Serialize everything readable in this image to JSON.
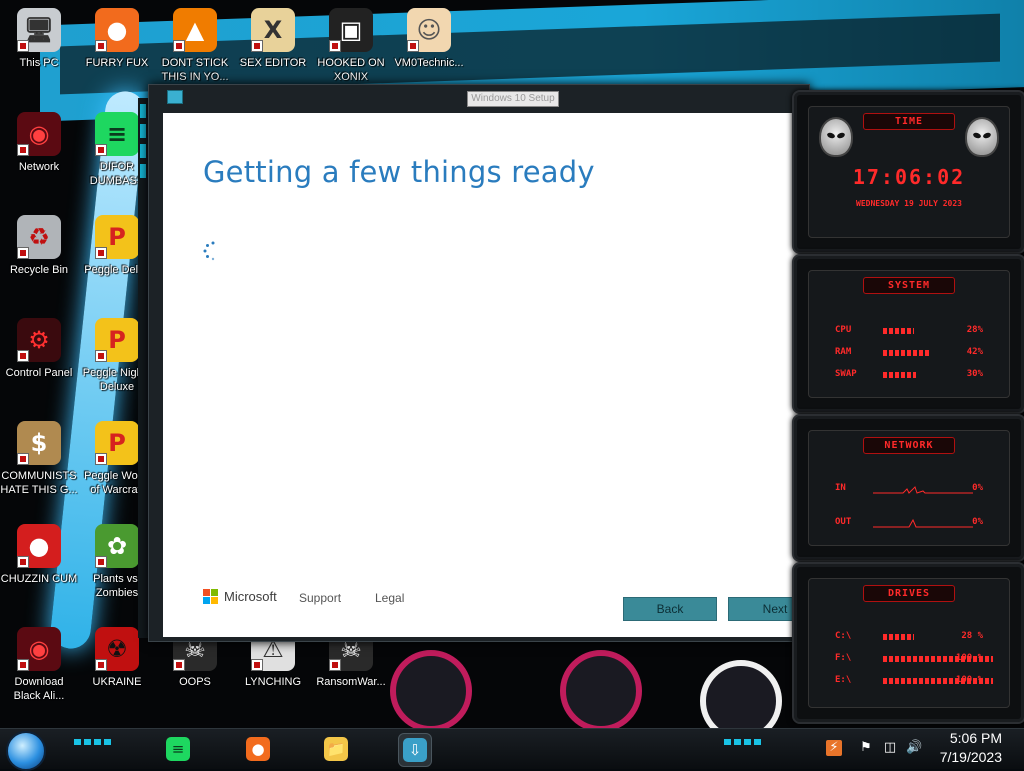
{
  "desktop": {
    "icons": [
      {
        "label": "This PC",
        "icon": "computer-icon"
      },
      {
        "label": "FURRY FUX",
        "icon": "firefox-icon"
      },
      {
        "label": "DONT STICK THIS IN YO...",
        "icon": "vlc-cone-icon"
      },
      {
        "label": "SEX EDITOR",
        "icon": "hxd-editor-icon"
      },
      {
        "label": "HOOKED ON XONIX",
        "icon": "xonix-icon"
      },
      {
        "label": "VM0Technic...",
        "icon": "doctor-icon"
      },
      {
        "label": "Network",
        "icon": "alien-network-icon"
      },
      {
        "label": "DIFOR DUMBASS",
        "icon": "spotify-icon"
      },
      {
        "label": "Recycle Bin",
        "icon": "recycle-bin-icon"
      },
      {
        "label": "Peggle Delux",
        "icon": "peggle-icon"
      },
      {
        "label": "Control Panel",
        "icon": "control-panel-icon"
      },
      {
        "label": "Peggle Nights Deluxe",
        "icon": "peggle-icon"
      },
      {
        "label": "COMMUNISTS HATE THIS G...",
        "icon": "money-bag-icon"
      },
      {
        "label": "Peggle World of Warcraft",
        "icon": "peggle-icon"
      },
      {
        "label": "CHUZZIN CUM",
        "icon": "chuzzle-icon"
      },
      {
        "label": "Plants vs. Zombies",
        "icon": "plants-vs-zombies-icon"
      },
      {
        "label": "Download Black Ali...",
        "icon": "alien-network-icon"
      },
      {
        "label": "UKRAINE",
        "icon": "radiation-icon"
      },
      {
        "label": "OOPS",
        "icon": "skull-icon"
      },
      {
        "label": "LYNCHING",
        "icon": "helmet-icon"
      },
      {
        "label": "RansomWar...",
        "icon": "skull-icon"
      }
    ]
  },
  "setup": {
    "window_title": "Windows 10 Setup",
    "heading": "Getting a few things ready",
    "brand": "Microsoft",
    "support": "Support",
    "legal": "Legal",
    "back": "Back",
    "next": "Next"
  },
  "gadgets": {
    "time": {
      "title": "TIME",
      "clock": "17:06:02",
      "date": "WEDNESDAY 19 JULY 2023"
    },
    "system": {
      "title": "SYSTEM",
      "rows": [
        {
          "key": "CPU",
          "value": "28%",
          "fill": 0.28
        },
        {
          "key": "RAM",
          "value": "42%",
          "fill": 0.42
        },
        {
          "key": "SWAP",
          "value": "30%",
          "fill": 0.3
        }
      ]
    },
    "network": {
      "title": "NETWORK",
      "rows": [
        {
          "key": "IN",
          "value": "0%"
        },
        {
          "key": "OUT",
          "value": "0%"
        }
      ]
    },
    "drives": {
      "title": "DRIVES",
      "rows": [
        {
          "key": "C:\\",
          "value": "28 %",
          "fill": 0.28
        },
        {
          "key": "F:\\",
          "value": "100 %",
          "fill": 1
        },
        {
          "key": "E:\\",
          "value": "100 %",
          "fill": 1
        }
      ]
    }
  },
  "taskbar": {
    "apps": [
      {
        "name": "spotify-icon"
      },
      {
        "name": "firefox-icon"
      },
      {
        "name": "file-explorer-icon"
      },
      {
        "name": "windows-setup-icon",
        "active": true
      }
    ],
    "time": "5:06 PM",
    "date": "7/19/2023"
  },
  "colors": {
    "accent_blue": "#2a7cbe",
    "gadget_red": "#ff2a2a",
    "taskbar_cyan": "#19c3e6"
  }
}
